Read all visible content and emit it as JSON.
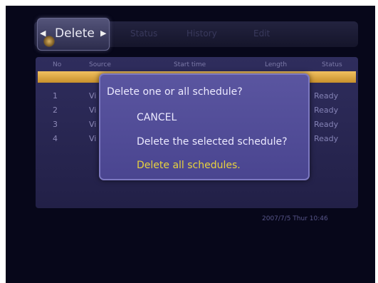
{
  "tabs": {
    "active": "Delete",
    "others": [
      "Status",
      "History",
      "Edit"
    ]
  },
  "table": {
    "headers": [
      "No",
      "Source",
      "Start time",
      "Length",
      "Status"
    ],
    "rows": [
      {
        "no": "1",
        "source": "Vi",
        "status": "Ready"
      },
      {
        "no": "2",
        "source": "Vi",
        "status": "Ready"
      },
      {
        "no": "3",
        "source": "Vi",
        "status": "Ready"
      },
      {
        "no": "4",
        "source": "Vi",
        "status": "Ready"
      }
    ]
  },
  "datetime": "2007/7/5 Thur 10:46",
  "dialog": {
    "title": "Delete one or all schedule?",
    "options": [
      "CANCEL",
      "Delete the selected schedule?",
      "Delete all schedules."
    ],
    "selected_index": 2
  },
  "colors": {
    "background": "#07071a",
    "panel": "#2a2852",
    "highlight": "#e8b04a",
    "dialog": "#524d98",
    "selected_text": "#e8d23e"
  }
}
